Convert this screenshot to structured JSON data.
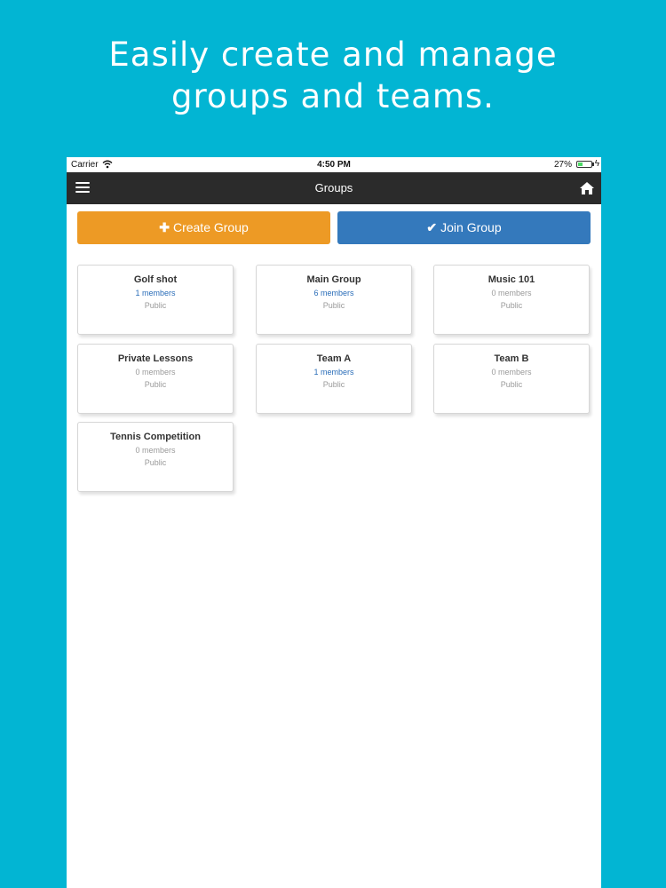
{
  "headline": {
    "line1": "Easily create and manage",
    "line2": "groups and teams."
  },
  "status_bar": {
    "carrier": "Carrier",
    "wifi_icon": "wifi-icon",
    "time": "4:50 PM",
    "battery": "27%",
    "battery_level": 0.27,
    "charging_icon": "bolt-icon"
  },
  "nav": {
    "menu_icon": "hamburger-menu-icon",
    "title": "Groups",
    "home_icon": "home-icon"
  },
  "actions": {
    "create": {
      "icon": "plus-icon",
      "glyph": "✚",
      "label": "Create Group",
      "color": "#ed9a25"
    },
    "join": {
      "icon": "checkmark-icon",
      "glyph": "✔",
      "label": "Join Group",
      "color": "#3479bc"
    }
  },
  "groups": [
    {
      "name": "Golf shot",
      "members": "1 members",
      "privacy": "Public",
      "member_count": 1
    },
    {
      "name": "Main Group",
      "members": "6 members",
      "privacy": "Public",
      "member_count": 6
    },
    {
      "name": "Music 101",
      "members": "0 members",
      "privacy": "Public",
      "member_count": 0
    },
    {
      "name": "Private Lessons",
      "members": "0 members",
      "privacy": "Public",
      "member_count": 0
    },
    {
      "name": "Team A",
      "members": "1 members",
      "privacy": "Public",
      "member_count": 1
    },
    {
      "name": "Team B",
      "members": "0 members",
      "privacy": "Public",
      "member_count": 0
    },
    {
      "name": "Tennis Competition",
      "members": "0 members",
      "privacy": "Public",
      "member_count": 0
    }
  ],
  "colors": {
    "background": "#02b5d3",
    "navbar": "#2b2b2b",
    "members_active": "#2a6db8"
  }
}
